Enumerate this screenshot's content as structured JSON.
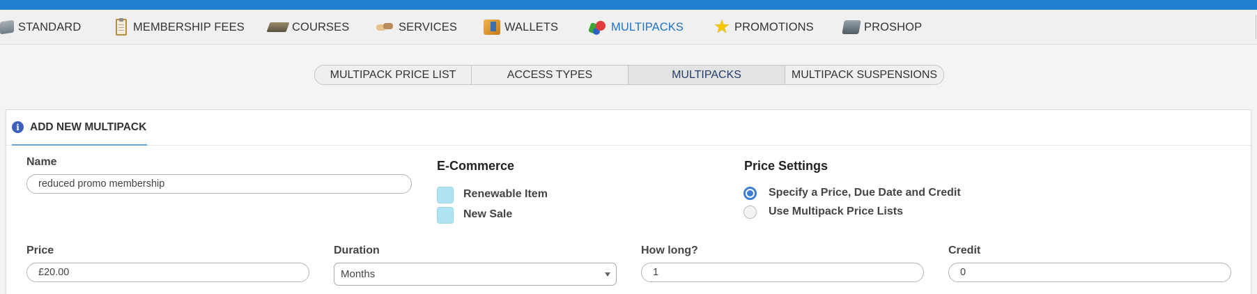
{
  "nav": {
    "items": [
      {
        "label": "STANDARD",
        "icon": "standard-icon"
      },
      {
        "label": "MEMBERSHIP FEES",
        "icon": "clipboard-icon"
      },
      {
        "label": "COURSES",
        "icon": "course-icon"
      },
      {
        "label": "SERVICES",
        "icon": "service-icon"
      },
      {
        "label": "WALLETS",
        "icon": "wallet-icon"
      },
      {
        "label": "MULTIPACKS",
        "icon": "multipack-icon",
        "active": true
      },
      {
        "label": "PROMOTIONS",
        "icon": "star-icon"
      },
      {
        "label": "PROSHOP",
        "icon": "till-icon"
      }
    ],
    "accent_color": "#1e73c4"
  },
  "tabs": [
    {
      "label": "MULTIPACK PRICE LIST"
    },
    {
      "label": "ACCESS TYPES"
    },
    {
      "label": "MULTIPACKS",
      "active": true
    },
    {
      "label": "MULTIPACK SUSPENSIONS"
    }
  ],
  "panel": {
    "title": "ADD NEW MULTIPACK",
    "info_icon_glyph": "i"
  },
  "form": {
    "name": {
      "label": "Name",
      "value": "reduced promo membership"
    },
    "ecommerce": {
      "title": "E-Commerce",
      "renewable_label": "Renewable Item",
      "new_sale_label": "New Sale"
    },
    "price_settings": {
      "title": "Price Settings",
      "option_specify": "Specify a Price, Due Date and Credit",
      "option_lists": "Use Multipack Price Lists",
      "selected": "option_specify"
    },
    "price": {
      "label": "Price",
      "value": "£20.00"
    },
    "duration": {
      "label": "Duration",
      "value": "Months"
    },
    "how_long": {
      "label": "How long?",
      "value": "1"
    },
    "credit": {
      "label": "Credit",
      "value": "0"
    }
  }
}
